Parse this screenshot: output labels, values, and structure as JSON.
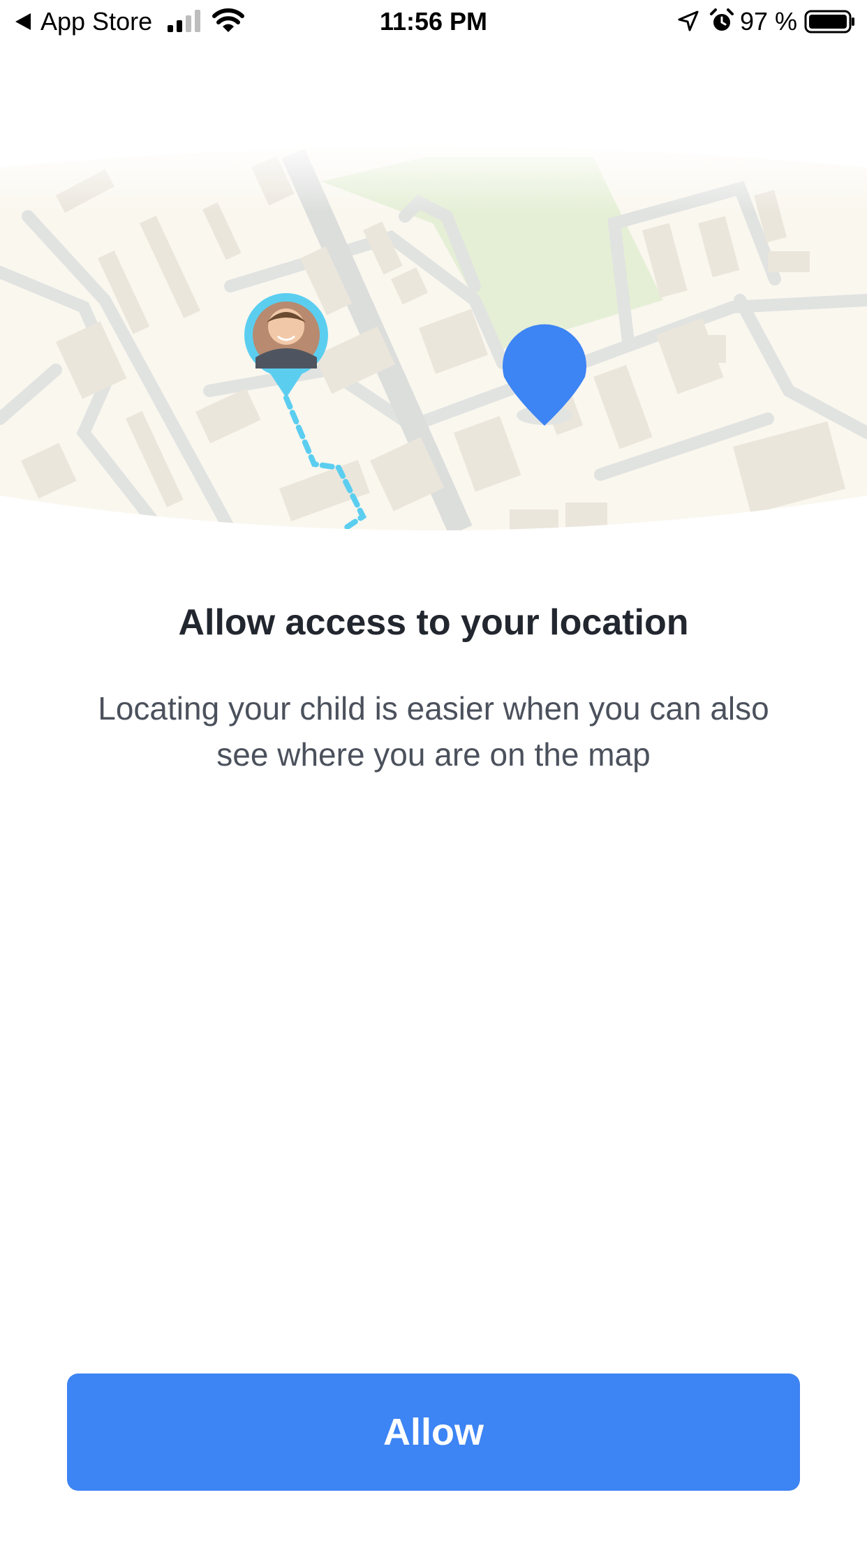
{
  "status_bar": {
    "back_label": "App Store",
    "time": "11:56 PM",
    "battery_percent": "97 %",
    "icons": [
      "back-arrow-icon",
      "cellular-signal-icon",
      "wifi-icon",
      "location-arrow-icon",
      "alarm-icon",
      "battery-icon"
    ]
  },
  "illustration": {
    "icons": [
      "child-avatar-pin-icon",
      "user-location-pin-icon",
      "dotted-route-icon"
    ],
    "colors": {
      "map_background": "#faf7ef",
      "buildings": "#ebe6dc",
      "roads": "#e1e3e1",
      "park": "#e5efd6",
      "child_pin": "#5bcef0",
      "user_pin": "#3d84f4"
    }
  },
  "content": {
    "title": "Allow access to your location",
    "description": "Locating your child is easier when you can also see where you are on the map"
  },
  "actions": {
    "allow_label": "Allow",
    "button_color": "#3d84f4"
  }
}
